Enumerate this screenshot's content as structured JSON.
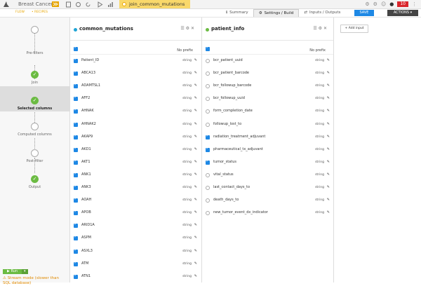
{
  "app": {
    "project": "Breast Cancer"
  },
  "recipe": {
    "name": "join_common_mutations"
  },
  "flow_tabs": [
    "FLOW",
    "• RECIPES"
  ],
  "tabs": [
    {
      "label": "Summary",
      "icon": "info-icon"
    },
    {
      "label": "Settings / Build",
      "icon": "gear-icon"
    },
    {
      "label": "Inputs / Outputs",
      "icon": "arrows-icon"
    }
  ],
  "save_label": "SAVE",
  "actions_label": "ACTIONS ▾",
  "notifications_count": "10",
  "steps": [
    {
      "label": "Pre-filters",
      "state": "open"
    },
    {
      "label": "Join",
      "state": "done"
    },
    {
      "label": "Selected columns",
      "state": "done",
      "selected": true
    },
    {
      "label": "Computed columns",
      "state": "open"
    },
    {
      "label": "Post-filter",
      "state": "open"
    },
    {
      "label": "Output",
      "state": "done"
    }
  ],
  "run": {
    "label": "Run",
    "warning": "Stream mode (slower than SQL database)"
  },
  "left_panel": {
    "title": "common_mutations",
    "color": "#1fa4d6",
    "no_prefix": "No prefix",
    "columns": [
      {
        "name": "Patient_ID",
        "type": "string",
        "checked": true
      },
      {
        "name": "ABCA13",
        "type": "string",
        "checked": true
      },
      {
        "name": "ADAMTSL1",
        "type": "string",
        "checked": true
      },
      {
        "name": "AFF2",
        "type": "string",
        "checked": true
      },
      {
        "name": "AHNAK",
        "type": "string",
        "checked": true
      },
      {
        "name": "AHNAK2",
        "type": "string",
        "checked": true
      },
      {
        "name": "AKAP9",
        "type": "string",
        "checked": true
      },
      {
        "name": "AKD1",
        "type": "string",
        "checked": true
      },
      {
        "name": "AKT1",
        "type": "string",
        "checked": true
      },
      {
        "name": "ANK1",
        "type": "string",
        "checked": true
      },
      {
        "name": "ANK3",
        "type": "string",
        "checked": true
      },
      {
        "name": "AOAH",
        "type": "string",
        "checked": true
      },
      {
        "name": "APOB",
        "type": "string",
        "checked": true
      },
      {
        "name": "ARID1A",
        "type": "string",
        "checked": true
      },
      {
        "name": "ASPM",
        "type": "string",
        "checked": true
      },
      {
        "name": "ASXL3",
        "type": "string",
        "checked": true
      },
      {
        "name": "ATM",
        "type": "string",
        "checked": true
      },
      {
        "name": "ATN1",
        "type": "string",
        "checked": true
      }
    ]
  },
  "right_panel": {
    "title": "patient_info",
    "color": "#6bbb42",
    "no_prefix": "No prefix",
    "columns": [
      {
        "name": "bcr_patient_uuid",
        "type": "string",
        "checked": false
      },
      {
        "name": "bcr_patient_barcode",
        "type": "string",
        "checked": false
      },
      {
        "name": "bcr_followup_barcode",
        "type": "string",
        "checked": false
      },
      {
        "name": "bcr_followup_uuid",
        "type": "string",
        "checked": false
      },
      {
        "name": "form_completion_date",
        "type": "string",
        "checked": false
      },
      {
        "name": "followup_lost_to",
        "type": "string",
        "checked": false
      },
      {
        "name": "radiation_treatment_adjuvant",
        "type": "string",
        "checked": true
      },
      {
        "name": "pharmaceutical_tx_adjuvant",
        "type": "string",
        "checked": true
      },
      {
        "name": "tumor_status",
        "type": "string",
        "checked": true
      },
      {
        "name": "vital_status",
        "type": "string",
        "checked": false
      },
      {
        "name": "last_contact_days_to",
        "type": "string",
        "checked": false
      },
      {
        "name": "death_days_to",
        "type": "string",
        "checked": false
      },
      {
        "name": "new_tumor_event_dx_indicator",
        "type": "string",
        "checked": false
      }
    ]
  },
  "add_input_label": "+ Add input"
}
